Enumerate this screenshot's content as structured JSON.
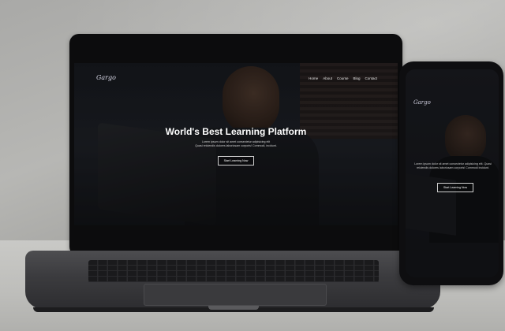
{
  "site": {
    "logo": "Gargo",
    "nav": [
      "Home",
      "About",
      "Course",
      "Blog",
      "Contact"
    ],
    "hero": {
      "title": "World's Best Learning Platform",
      "text_line1": "Lorem ipsum dolor sit amet consectetur adipisicing elit",
      "text_line2": "Quasi reiciendis dolores laboriosam corporis! Commodi, incidunt.",
      "button": "Start Learning Now"
    }
  },
  "mobile": {
    "logo": "Gargo",
    "text": "Lorem ipsum dolor sit amet consectetur adipisicing elit. Quasi reiciendis dolores laboriosam corporis! Commodi incidunt.",
    "button": "Start Learning Now"
  }
}
